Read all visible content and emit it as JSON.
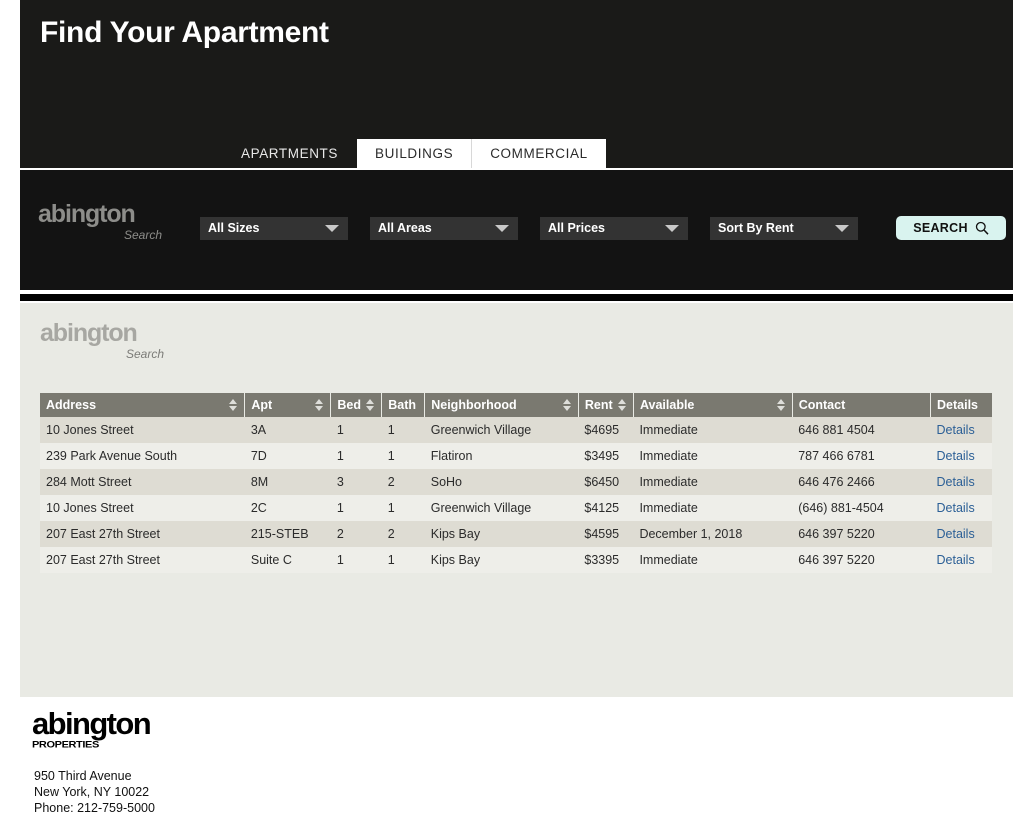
{
  "hero": {
    "title": "Find Your Apartment"
  },
  "tabs": [
    {
      "label": "APARTMENTS",
      "active": true
    },
    {
      "label": "BUILDINGS",
      "active": false
    },
    {
      "label": "COMMERCIAL",
      "active": false
    }
  ],
  "search": {
    "logo_word": "abington",
    "logo_sub": "Search",
    "filters": [
      {
        "name": "size",
        "value": "All Sizes"
      },
      {
        "name": "area",
        "value": "All Areas"
      },
      {
        "name": "price",
        "value": "All Prices"
      },
      {
        "name": "sort",
        "value": "Sort By Rent"
      }
    ],
    "button_label": "SEARCH",
    "button_icon": "magnifier-icon",
    "button_color": "#d9f3ef"
  },
  "results": {
    "logo_word": "abington",
    "logo_sub": "Search",
    "columns": [
      {
        "label": "Address",
        "sortable": true
      },
      {
        "label": "Apt",
        "sortable": true
      },
      {
        "label": "Bed",
        "sortable": true
      },
      {
        "label": "Bath",
        "sortable": false
      },
      {
        "label": "Neighborhood",
        "sortable": true
      },
      {
        "label": "Rent",
        "sortable": true
      },
      {
        "label": "Available",
        "sortable": true
      },
      {
        "label": "Contact",
        "sortable": false
      },
      {
        "label": "Details",
        "sortable": false
      }
    ],
    "details_label": "Details",
    "rows": [
      {
        "address": "10 Jones Street",
        "apt": "3A",
        "bed": "1",
        "bath": "1",
        "neighborhood": "Greenwich Village",
        "rent": "$4695",
        "available": "Immediate",
        "contact": "646 881 4504",
        "details": "Details"
      },
      {
        "address": "239 Park Avenue South",
        "apt": "7D",
        "bed": "1",
        "bath": "1",
        "neighborhood": "Flatiron",
        "rent": "$3495",
        "available": "Immediate",
        "contact": "787 466 6781",
        "details": "Details"
      },
      {
        "address": "284 Mott Street",
        "apt": "8M",
        "bed": "3",
        "bath": "2",
        "neighborhood": "SoHo",
        "rent": "$6450",
        "available": "Immediate",
        "contact": "646 476 2466",
        "details": "Details"
      },
      {
        "address": "10 Jones Street",
        "apt": "2C",
        "bed": "1",
        "bath": "1",
        "neighborhood": "Greenwich Village",
        "rent": "$4125",
        "available": "Immediate",
        "contact": "(646) 881-4504",
        "details": "Details"
      },
      {
        "address": "207 East 27th Street",
        "apt": "215-STEB",
        "bed": "2",
        "bath": "2",
        "neighborhood": "Kips Bay",
        "rent": "$4595",
        "available": "December 1, 2018",
        "contact": "646 397 5220",
        "details": "Details"
      },
      {
        "address": "207 East 27th Street",
        "apt": "Suite C",
        "bed": "1",
        "bath": "1",
        "neighborhood": "Kips Bay",
        "rent": "$3395",
        "available": "Immediate",
        "contact": "646 397 5220",
        "details": "Details"
      }
    ]
  },
  "footer": {
    "logo_word": "abington",
    "logo_sub": "PROPERTIES",
    "address_line1": "950 Third Avenue",
    "address_line2": "New York, NY 10022",
    "address_line3": "Phone: 212-759-5000"
  },
  "colors": {
    "header_bg": "#1a1a18",
    "search_bg": "#131313",
    "panel_bg": "#e9eae4",
    "table_header_bg": "#7a7970",
    "row_odd": "#dedcd3",
    "row_even": "#eeeee9",
    "link": "#2b5f96",
    "accent_button": "#d9f3ef"
  }
}
